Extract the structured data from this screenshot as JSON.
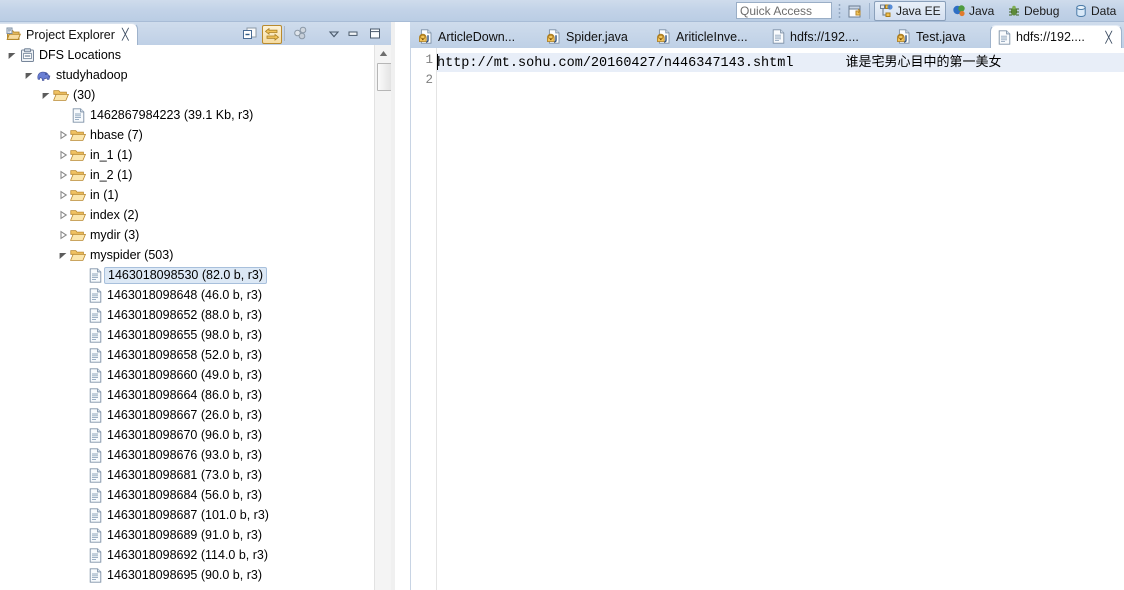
{
  "toolbar": {
    "quick_access_placeholder": "Quick Access",
    "open_perspective_icon": "open-perspective-icon",
    "perspectives": [
      {
        "label": "Java EE",
        "icon": "java-ee-perspective-icon",
        "active": true
      },
      {
        "label": "Java",
        "icon": "java-perspective-icon",
        "active": false
      },
      {
        "label": "Debug",
        "icon": "debug-perspective-icon",
        "active": false
      },
      {
        "label": "Data",
        "icon": "database-perspective-icon",
        "active": false
      }
    ]
  },
  "project_explorer": {
    "title": "Project Explorer",
    "close_glyph": "╳",
    "tools": [
      {
        "name": "collapse-all-icon",
        "toggled": false
      },
      {
        "name": "link-with-editor-icon",
        "toggled": true
      },
      {
        "name": "view-filters-icon",
        "toggled": false
      },
      {
        "name": "view-menu-icon",
        "toggled": false
      },
      {
        "name": "minimize-icon",
        "toggled": false
      },
      {
        "name": "maximize-icon",
        "toggled": false
      }
    ],
    "tree": [
      {
        "label": "DFS Locations",
        "indent": 0,
        "icon": "dfs-locations-icon",
        "twisty": "expanded",
        "selected": false
      },
      {
        "label": "studyhadoop",
        "indent": 1,
        "icon": "hadoop-elephant-icon",
        "twisty": "expanded",
        "selected": false
      },
      {
        "label": "(30)",
        "indent": 2,
        "icon": "folder-open-icon",
        "twisty": "expanded",
        "selected": false
      },
      {
        "label": "1462867984223 (39.1 Kb, r3)",
        "indent": 3,
        "icon": "file-icon",
        "twisty": "none",
        "selected": false
      },
      {
        "label": "hbase (7)",
        "indent": 3,
        "icon": "folder-open-icon",
        "twisty": "collapsed",
        "selected": false
      },
      {
        "label": "in_1 (1)",
        "indent": 3,
        "icon": "folder-open-icon",
        "twisty": "collapsed",
        "selected": false
      },
      {
        "label": "in_2 (1)",
        "indent": 3,
        "icon": "folder-open-icon",
        "twisty": "collapsed",
        "selected": false
      },
      {
        "label": "in (1)",
        "indent": 3,
        "icon": "folder-open-icon",
        "twisty": "collapsed",
        "selected": false
      },
      {
        "label": "index (2)",
        "indent": 3,
        "icon": "folder-open-icon",
        "twisty": "collapsed",
        "selected": false
      },
      {
        "label": "mydir (3)",
        "indent": 3,
        "icon": "folder-open-icon",
        "twisty": "collapsed",
        "selected": false
      },
      {
        "label": "myspider (503)",
        "indent": 3,
        "icon": "folder-open-icon",
        "twisty": "expanded",
        "selected": false
      },
      {
        "label": "1463018098530 (82.0 b, r3)",
        "indent": 4,
        "icon": "file-icon",
        "twisty": "none",
        "selected": true
      },
      {
        "label": "1463018098648 (46.0 b, r3)",
        "indent": 4,
        "icon": "file-icon",
        "twisty": "none",
        "selected": false
      },
      {
        "label": "1463018098652 (88.0 b, r3)",
        "indent": 4,
        "icon": "file-icon",
        "twisty": "none",
        "selected": false
      },
      {
        "label": "1463018098655 (98.0 b, r3)",
        "indent": 4,
        "icon": "file-icon",
        "twisty": "none",
        "selected": false
      },
      {
        "label": "1463018098658 (52.0 b, r3)",
        "indent": 4,
        "icon": "file-icon",
        "twisty": "none",
        "selected": false
      },
      {
        "label": "1463018098660 (49.0 b, r3)",
        "indent": 4,
        "icon": "file-icon",
        "twisty": "none",
        "selected": false
      },
      {
        "label": "1463018098664 (86.0 b, r3)",
        "indent": 4,
        "icon": "file-icon",
        "twisty": "none",
        "selected": false
      },
      {
        "label": "1463018098667 (26.0 b, r3)",
        "indent": 4,
        "icon": "file-icon",
        "twisty": "none",
        "selected": false
      },
      {
        "label": "1463018098670 (96.0 b, r3)",
        "indent": 4,
        "icon": "file-icon",
        "twisty": "none",
        "selected": false
      },
      {
        "label": "1463018098676 (93.0 b, r3)",
        "indent": 4,
        "icon": "file-icon",
        "twisty": "none",
        "selected": false
      },
      {
        "label": "1463018098681 (73.0 b, r3)",
        "indent": 4,
        "icon": "file-icon",
        "twisty": "none",
        "selected": false
      },
      {
        "label": "1463018098684 (56.0 b, r3)",
        "indent": 4,
        "icon": "file-icon",
        "twisty": "none",
        "selected": false
      },
      {
        "label": "1463018098687 (101.0 b, r3)",
        "indent": 4,
        "icon": "file-icon",
        "twisty": "none",
        "selected": false
      },
      {
        "label": "1463018098689 (91.0 b, r3)",
        "indent": 4,
        "icon": "file-icon",
        "twisty": "none",
        "selected": false
      },
      {
        "label": "1463018098692 (114.0 b, r3)",
        "indent": 4,
        "icon": "file-icon",
        "twisty": "none",
        "selected": false
      },
      {
        "label": "1463018098695 (90.0 b, r3)",
        "indent": 4,
        "icon": "file-icon",
        "twisty": "none",
        "selected": false
      }
    ],
    "scrollbar": {
      "up_arrow_glyph": "▲"
    }
  },
  "editor": {
    "tabs": [
      {
        "label": "ArticleDown...",
        "icon": "java-file-icon",
        "active": false,
        "closable": false
      },
      {
        "label": "Spider.java",
        "icon": "java-file-icon",
        "active": false,
        "closable": false
      },
      {
        "label": "AriticleInve...",
        "icon": "java-file-icon",
        "active": false,
        "closable": false
      },
      {
        "label": "hdfs://192....",
        "icon": "text-file-icon",
        "active": false,
        "closable": false
      },
      {
        "label": "Test.java",
        "icon": "java-file-icon",
        "active": false,
        "closable": false
      },
      {
        "label": "hdfs://192....",
        "icon": "text-file-icon",
        "active": true,
        "closable": true,
        "close_glyph": "╳"
      }
    ],
    "line_numbers": [
      "1",
      "2"
    ],
    "lines": [
      {
        "text": "http://mt.sohu.com/20160427/n446347143.shtml",
        "cjk": "谁是宅男心目中的第一美女",
        "highlighted": true
      },
      {
        "text": "",
        "cjk": "",
        "highlighted": false
      }
    ]
  },
  "colors": {
    "coolbar_top": "#cfdcec",
    "coolbar_bottom": "#bacde4",
    "tab_active_bg": "#ffffff",
    "selection_bg": "#dce8f5",
    "current_line_bg": "#e8eef8",
    "line_number_fg": "#808080",
    "folder_icon": "#e8b34a",
    "file_icon": "#9fb4cc"
  }
}
